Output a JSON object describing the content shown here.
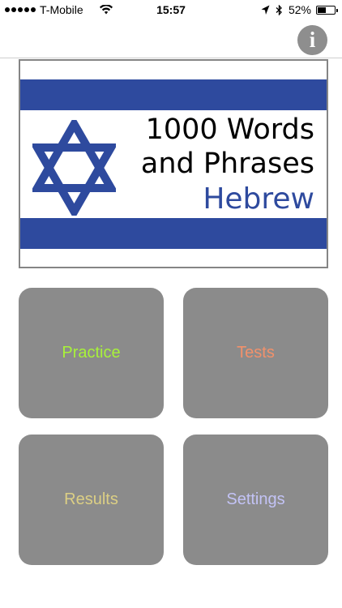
{
  "status_bar": {
    "carrier": "T-Mobile",
    "time": "15:57",
    "battery_percent": "52%",
    "battery_level": 0.52
  },
  "nav": {
    "info_icon": "info-icon",
    "info_label": "i"
  },
  "banner": {
    "title_line1": "1000 Words",
    "title_line2": "and Phrases",
    "language": "Hebrew",
    "colors": {
      "flag_blue": "#2e4a9e",
      "background": "#ffffff"
    }
  },
  "menu": {
    "practice": {
      "label": "Practice",
      "color": "#a8f23a"
    },
    "tests": {
      "label": "Tests",
      "color": "#f2916b"
    },
    "results": {
      "label": "Results",
      "color": "#dccf84"
    },
    "settings": {
      "label": "Settings",
      "color": "#c3c3f6"
    },
    "tile_color": "#8b8b8b"
  }
}
